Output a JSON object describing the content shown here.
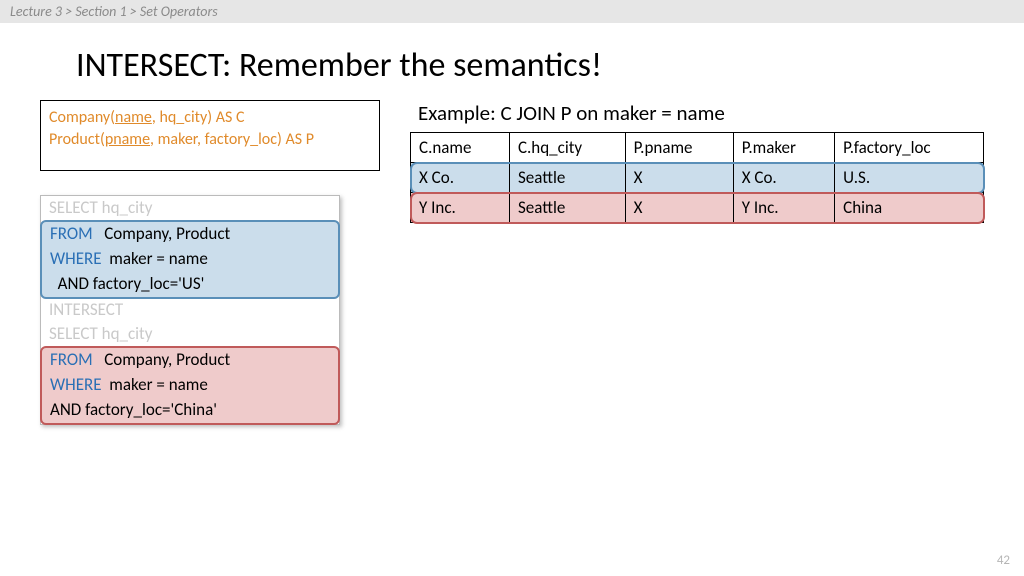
{
  "breadcrumb": "Lecture 3  >  Section 1  >  Set Operators",
  "title": "INTERSECT: Remember the semantics!",
  "schema": {
    "line1_pre": "Company(",
    "line1_u": "name",
    "line1_post": ", hq_city) AS C",
    "line2_pre": "Product(",
    "line2_u": "pname",
    "line2_post": ", maker, factory_loc) AS P"
  },
  "sql": {
    "l1": "SELECT hq_city",
    "l2a": "FROM",
    "l2b": "   Company, Product",
    "l3a": "WHERE",
    "l3b": "  maker = name",
    "l4": "  AND factory_loc='US'",
    "l5": "INTERSECT",
    "l6": "SELECT hq_city",
    "l7a": "FROM",
    "l7b": "   Company, Product",
    "l8a": "WHERE",
    "l8b": "  maker = name",
    "l9": "AND factory_loc='China'"
  },
  "example_title": "Example:   C  JOIN  P on maker = name",
  "table": {
    "headers": [
      "C.name",
      "C.hq_city",
      "P.pname",
      "P.maker",
      "P.factory_loc"
    ],
    "rows": [
      {
        "class": "row-blue",
        "cells": [
          "X Co.",
          "Seattle",
          "X",
          "X Co.",
          "U.S."
        ]
      },
      {
        "class": "row-red",
        "cells": [
          "Y Inc.",
          "Seattle",
          "X",
          "Y Inc.",
          "China"
        ]
      }
    ]
  },
  "page_number": "42"
}
